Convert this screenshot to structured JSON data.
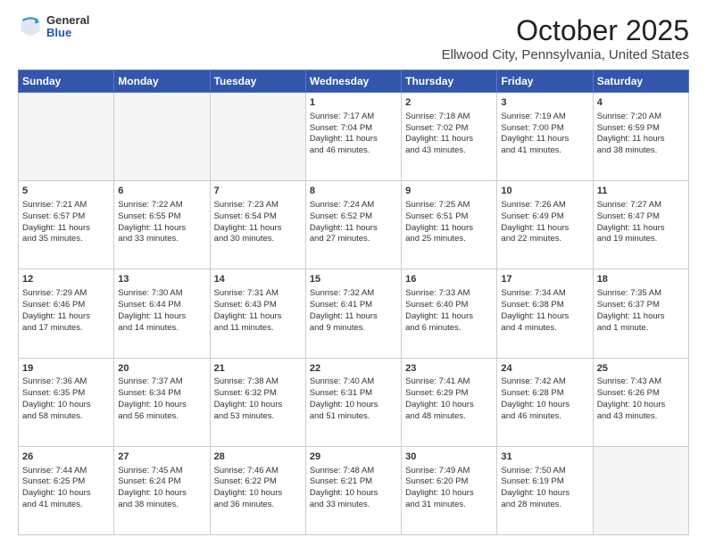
{
  "header": {
    "logo_general": "General",
    "logo_blue": "Blue",
    "month": "October 2025",
    "location": "Ellwood City, Pennsylvania, United States"
  },
  "days_of_week": [
    "Sunday",
    "Monday",
    "Tuesday",
    "Wednesday",
    "Thursday",
    "Friday",
    "Saturday"
  ],
  "weeks": [
    [
      {
        "day": "",
        "info": ""
      },
      {
        "day": "",
        "info": ""
      },
      {
        "day": "",
        "info": ""
      },
      {
        "day": "1",
        "info": "Sunrise: 7:17 AM\nSunset: 7:04 PM\nDaylight: 11 hours\nand 46 minutes."
      },
      {
        "day": "2",
        "info": "Sunrise: 7:18 AM\nSunset: 7:02 PM\nDaylight: 11 hours\nand 43 minutes."
      },
      {
        "day": "3",
        "info": "Sunrise: 7:19 AM\nSunset: 7:00 PM\nDaylight: 11 hours\nand 41 minutes."
      },
      {
        "day": "4",
        "info": "Sunrise: 7:20 AM\nSunset: 6:59 PM\nDaylight: 11 hours\nand 38 minutes."
      }
    ],
    [
      {
        "day": "5",
        "info": "Sunrise: 7:21 AM\nSunset: 6:57 PM\nDaylight: 11 hours\nand 35 minutes."
      },
      {
        "day": "6",
        "info": "Sunrise: 7:22 AM\nSunset: 6:55 PM\nDaylight: 11 hours\nand 33 minutes."
      },
      {
        "day": "7",
        "info": "Sunrise: 7:23 AM\nSunset: 6:54 PM\nDaylight: 11 hours\nand 30 minutes."
      },
      {
        "day": "8",
        "info": "Sunrise: 7:24 AM\nSunset: 6:52 PM\nDaylight: 11 hours\nand 27 minutes."
      },
      {
        "day": "9",
        "info": "Sunrise: 7:25 AM\nSunset: 6:51 PM\nDaylight: 11 hours\nand 25 minutes."
      },
      {
        "day": "10",
        "info": "Sunrise: 7:26 AM\nSunset: 6:49 PM\nDaylight: 11 hours\nand 22 minutes."
      },
      {
        "day": "11",
        "info": "Sunrise: 7:27 AM\nSunset: 6:47 PM\nDaylight: 11 hours\nand 19 minutes."
      }
    ],
    [
      {
        "day": "12",
        "info": "Sunrise: 7:29 AM\nSunset: 6:46 PM\nDaylight: 11 hours\nand 17 minutes."
      },
      {
        "day": "13",
        "info": "Sunrise: 7:30 AM\nSunset: 6:44 PM\nDaylight: 11 hours\nand 14 minutes."
      },
      {
        "day": "14",
        "info": "Sunrise: 7:31 AM\nSunset: 6:43 PM\nDaylight: 11 hours\nand 11 minutes."
      },
      {
        "day": "15",
        "info": "Sunrise: 7:32 AM\nSunset: 6:41 PM\nDaylight: 11 hours\nand 9 minutes."
      },
      {
        "day": "16",
        "info": "Sunrise: 7:33 AM\nSunset: 6:40 PM\nDaylight: 11 hours\nand 6 minutes."
      },
      {
        "day": "17",
        "info": "Sunrise: 7:34 AM\nSunset: 6:38 PM\nDaylight: 11 hours\nand 4 minutes."
      },
      {
        "day": "18",
        "info": "Sunrise: 7:35 AM\nSunset: 6:37 PM\nDaylight: 11 hours\nand 1 minute."
      }
    ],
    [
      {
        "day": "19",
        "info": "Sunrise: 7:36 AM\nSunset: 6:35 PM\nDaylight: 10 hours\nand 58 minutes."
      },
      {
        "day": "20",
        "info": "Sunrise: 7:37 AM\nSunset: 6:34 PM\nDaylight: 10 hours\nand 56 minutes."
      },
      {
        "day": "21",
        "info": "Sunrise: 7:38 AM\nSunset: 6:32 PM\nDaylight: 10 hours\nand 53 minutes."
      },
      {
        "day": "22",
        "info": "Sunrise: 7:40 AM\nSunset: 6:31 PM\nDaylight: 10 hours\nand 51 minutes."
      },
      {
        "day": "23",
        "info": "Sunrise: 7:41 AM\nSunset: 6:29 PM\nDaylight: 10 hours\nand 48 minutes."
      },
      {
        "day": "24",
        "info": "Sunrise: 7:42 AM\nSunset: 6:28 PM\nDaylight: 10 hours\nand 46 minutes."
      },
      {
        "day": "25",
        "info": "Sunrise: 7:43 AM\nSunset: 6:26 PM\nDaylight: 10 hours\nand 43 minutes."
      }
    ],
    [
      {
        "day": "26",
        "info": "Sunrise: 7:44 AM\nSunset: 6:25 PM\nDaylight: 10 hours\nand 41 minutes."
      },
      {
        "day": "27",
        "info": "Sunrise: 7:45 AM\nSunset: 6:24 PM\nDaylight: 10 hours\nand 38 minutes."
      },
      {
        "day": "28",
        "info": "Sunrise: 7:46 AM\nSunset: 6:22 PM\nDaylight: 10 hours\nand 36 minutes."
      },
      {
        "day": "29",
        "info": "Sunrise: 7:48 AM\nSunset: 6:21 PM\nDaylight: 10 hours\nand 33 minutes."
      },
      {
        "day": "30",
        "info": "Sunrise: 7:49 AM\nSunset: 6:20 PM\nDaylight: 10 hours\nand 31 minutes."
      },
      {
        "day": "31",
        "info": "Sunrise: 7:50 AM\nSunset: 6:19 PM\nDaylight: 10 hours\nand 28 minutes."
      },
      {
        "day": "",
        "info": ""
      }
    ]
  ]
}
